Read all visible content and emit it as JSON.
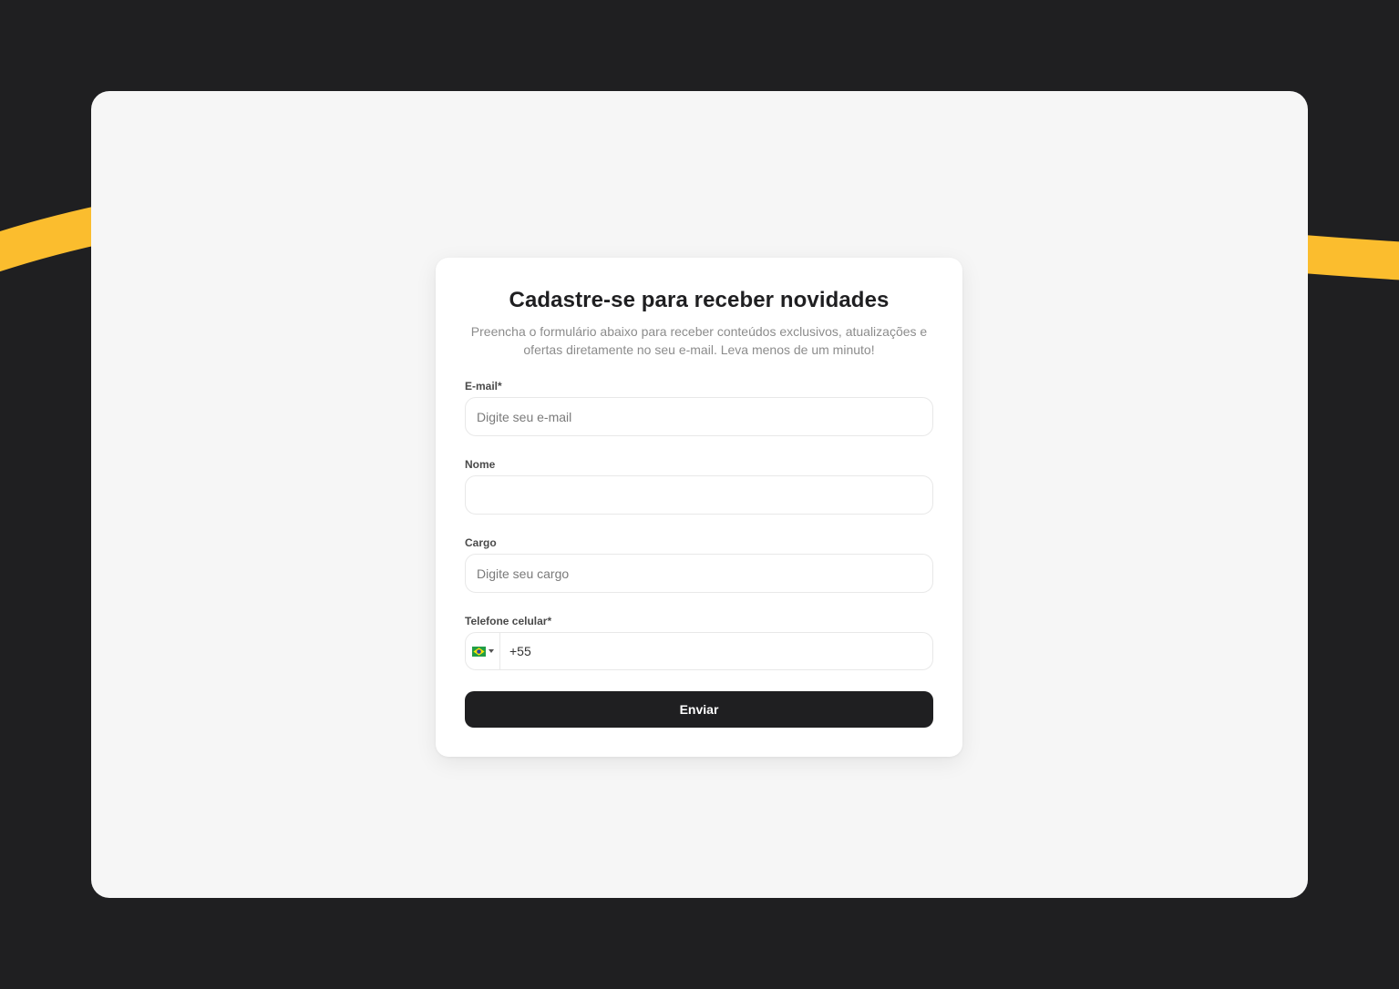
{
  "colors": {
    "background": "#1f1f21",
    "panel": "#f6f6f6",
    "card": "#ffffff",
    "accent_swoosh": "#fbbd2e",
    "button": "#1f1f21",
    "button_text": "#ffffff"
  },
  "form": {
    "title": "Cadastre-se para receber novidades",
    "subtitle": "Preencha o formulário abaixo para receber conteúdos exclusivos, atualizações e ofertas diretamente no seu e-mail. Leva menos de um minuto!",
    "email": {
      "label": "E-mail*",
      "placeholder": "Digite seu e-mail",
      "value": ""
    },
    "nome": {
      "label": "Nome",
      "placeholder": "",
      "value": ""
    },
    "cargo": {
      "label": "Cargo",
      "placeholder": "Digite seu cargo",
      "value": ""
    },
    "phone": {
      "label": "Telefone celular*",
      "country_icon": "brazil-flag-icon",
      "value": "+55"
    },
    "submit_label": "Enviar"
  }
}
